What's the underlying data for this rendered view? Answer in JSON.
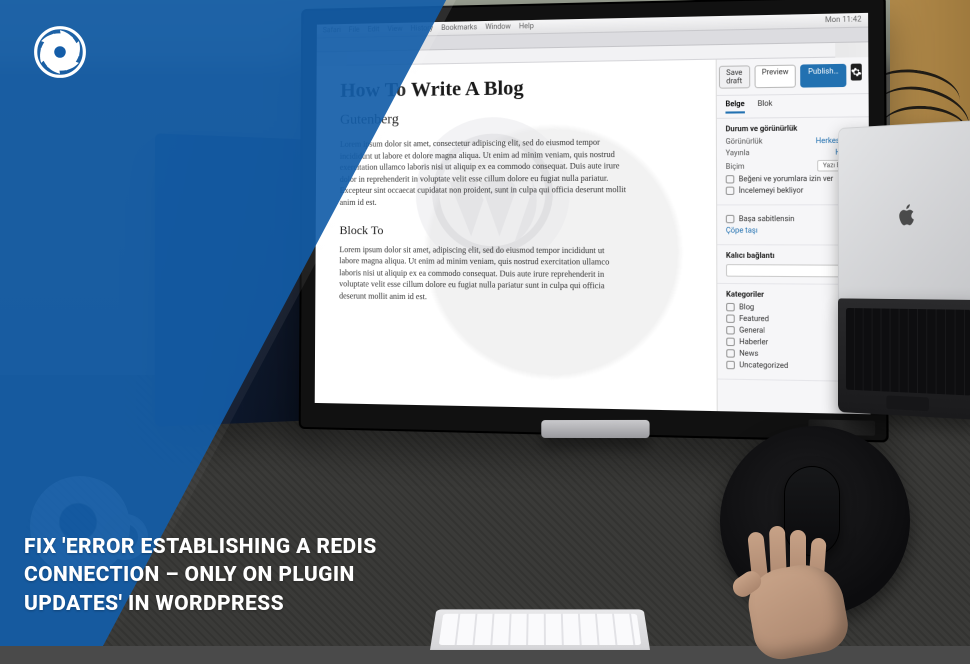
{
  "overlay": {
    "color": "#145da8",
    "headline": "FIX 'ERROR ESTABLISHING A REDIS CONNECTION – ONLY ON PLUGIN UPDATES' IN WORDPRESS"
  },
  "brand": {
    "name": "aperture-logo"
  },
  "macos_menubar": {
    "items": [
      "Safari",
      "File",
      "Edit",
      "View",
      "History",
      "Bookmarks",
      "Window",
      "Help"
    ],
    "right": "Mon 11:42"
  },
  "wp_editor": {
    "top_buttons": {
      "save_draft": "Save draft",
      "preview": "Preview",
      "publish": "Publish…"
    },
    "sidebar": {
      "tabs": {
        "post": "Belge",
        "block": "Blok"
      },
      "status_panel": {
        "title": "Durum ve görünürlük",
        "rows": {
          "visibility": "Görünürlük",
          "visibility_value": "Herkese açık",
          "publish": "Yayınla",
          "publish_value": "Hemen"
        },
        "checkboxes": [
          "Beğeni ve yorumlara izin ver",
          "İncelemeyi bekliyor"
        ],
        "format_label": "Biçim",
        "format_value": "Yazı biçimi"
      },
      "sticky_panel": {
        "label": "Başa sabitlensin",
        "move_to_trash": "Çöpe taşı"
      },
      "permalink_panel": {
        "title": "Kalıcı bağlantı"
      },
      "categories_panel": {
        "title": "Kategoriler",
        "items": [
          "Blog",
          "Featured",
          "General",
          "Haberler",
          "News",
          "Uncategorized"
        ]
      }
    },
    "content": {
      "post_title": "How To Write A Blog",
      "subheading": "Gutenberg",
      "block_heading": "Block To",
      "lorem1": "Lorem ipsum dolor sit amet, consectetur adipiscing elit, sed do eiusmod tempor incididunt ut labore et dolore magna aliqua. Ut enim ad minim veniam, quis nostrud exercitation ullamco laboris nisi ut aliquip ex ea commodo consequat. Duis aute irure dolor in reprehenderit in voluptate velit esse cillum dolore eu fugiat nulla pariatur. Excepteur sint occaecat cupidatat non proident, sunt in culpa qui officia deserunt mollit anim id est.",
      "lorem2": "Lorem ipsum dolor sit amet, adipiscing elit, sed do eiusmod tempor incididunt ut labore magna aliqua. Ut enim ad minim veniam, quis nostrud exercitation ullamco laboris nisi ut aliquip ex ea commodo consequat. Duis aute irure reprehenderit in voluptate velit esse cillum dolore eu fugiat nulla pariatur sunt in culpa qui officia deserunt mollit anim id est."
    }
  },
  "laptop": {
    "brand": "apple-logo"
  }
}
